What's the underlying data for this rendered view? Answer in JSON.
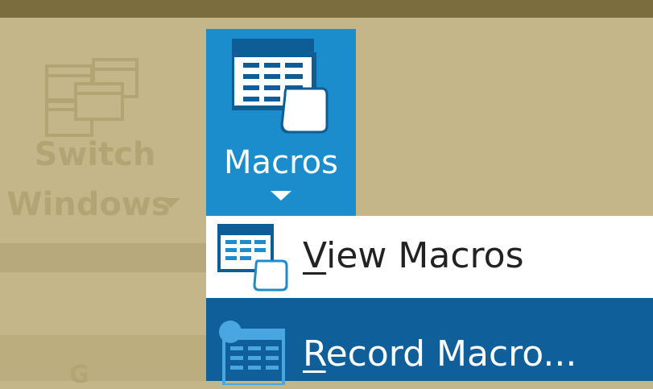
{
  "ribbon": {
    "switch_windows": {
      "line1": "Switch",
      "line2": "Windows",
      "icon": "windows-icon"
    },
    "partial_label": "G",
    "macros": {
      "label": "Macros",
      "icon": "macro-sheet-icon"
    }
  },
  "macros_menu": {
    "items": [
      {
        "accelerator": "V",
        "label_rest": "iew Macros",
        "icon": "view-macros-icon"
      },
      {
        "accelerator": "R",
        "label_rest": "ecord Macro...",
        "icon": "record-macro-icon"
      }
    ]
  },
  "colors": {
    "background": "#c4b689",
    "top_bar": "#7b6d3e",
    "macros_button": "#1b8ccc",
    "menu_highlight": "#0f5f9b",
    "menu_bg": "#ffffff"
  }
}
